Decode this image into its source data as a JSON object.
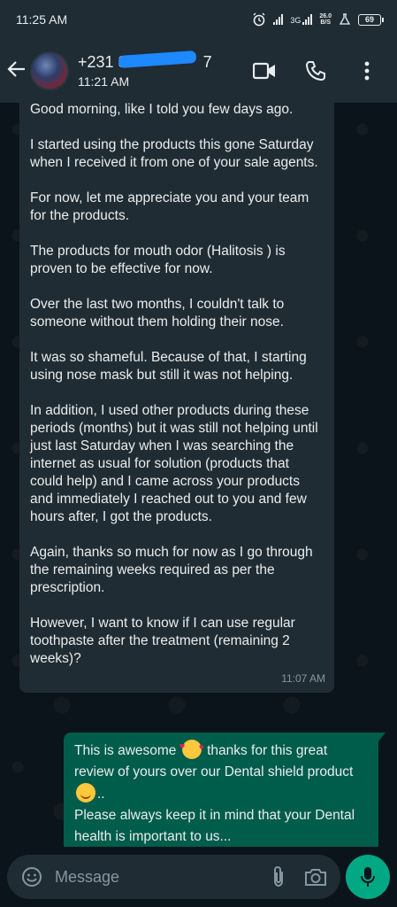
{
  "status_bar": {
    "time": "11:25 AM",
    "network": "3G",
    "speed_value": "26.0",
    "speed_unit": "B/S",
    "battery": "69"
  },
  "header": {
    "contact_name": "+231 8",
    "contact_suffix": "7",
    "subtitle": "11:21 AM",
    "icons": [
      "back-arrow-icon",
      "video-call-icon",
      "phone-icon",
      "more-vert-icon"
    ]
  },
  "messages": {
    "incoming": {
      "paragraphs": [
        "Good morning, like I told you few days ago.",
        "I started using the products this gone Saturday when I received it from one of your sale agents.",
        "For now, let me appreciate you and your team for the products.",
        "The products for mouth odor (Halitosis ) is proven to be effective for now.",
        "Over the last two months, I couldn't talk to someone without them holding their nose.",
        "It was so shameful. Because of that, I starting using nose mask but still it was not helping.",
        "In addition, I used other products during these periods (months) but it was still not helping until just last Saturday when I was searching the internet as usual for solution (products that could help) and I came across your products and immediately I reached out to you and few hours after, I got the products.",
        "Again, thanks so much for now as I go through the remaining weeks required as per the prescription.",
        "However, I want to know if I can use regular toothpaste after the treatment (remaining 2 weeks)?"
      ],
      "time": "11:07 AM"
    },
    "outgoing": {
      "part1": "This is awesome",
      "part2": "thanks for this great review of yours over our Dental shield product",
      "part3": "..",
      "part4": "Please always keep it in mind that your Dental health is important to us..."
    }
  },
  "input": {
    "placeholder": "Message",
    "value": ""
  },
  "colors": {
    "header_bg": "#1f2c34",
    "chat_bg": "#0b141a",
    "incoming_bubble": "#202c33",
    "outgoing_bubble": "#005c4b",
    "accent": "#00a884"
  }
}
